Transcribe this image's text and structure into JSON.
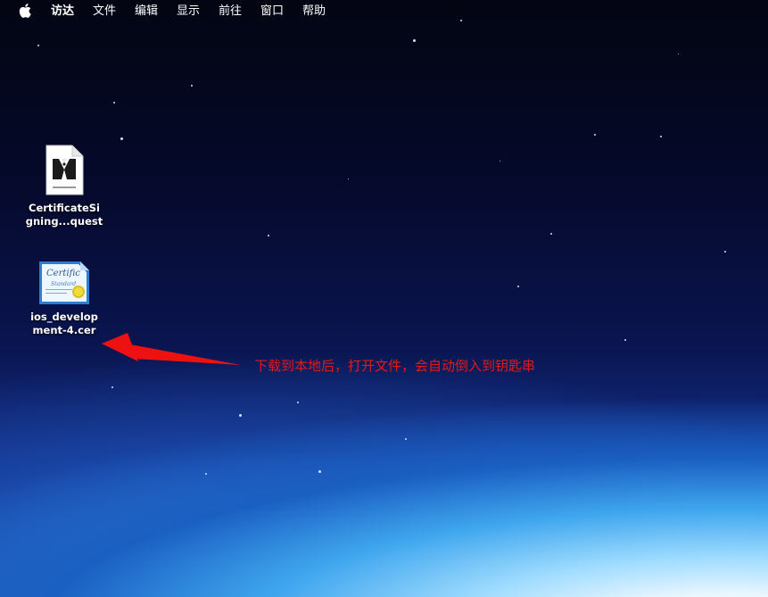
{
  "menubar": {
    "items": [
      "访达",
      "文件",
      "编辑",
      "显示",
      "前往",
      "窗口",
      "帮助"
    ]
  },
  "desktop_icons": [
    {
      "label_line1": "CertificateSi",
      "label_line2": "gning...quest",
      "icon": "certificate-signing-request-icon"
    },
    {
      "label_line1": "ios_develop",
      "label_line2": "ment-4.cer",
      "icon": "certificate-file-icon"
    }
  ],
  "annotation": {
    "text": "下载到本地后，打开文件，会自动倒入到钥匙串",
    "color": "#e11a1a"
  },
  "colors": {
    "menu_text": "#ffffff",
    "arrow": "#ee1111"
  }
}
